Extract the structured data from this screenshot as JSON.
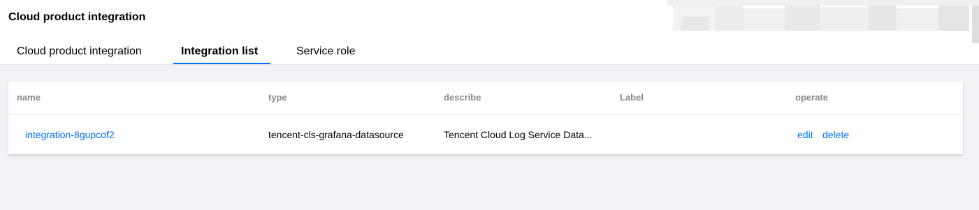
{
  "page": {
    "title": "Cloud product integration"
  },
  "tabs": [
    {
      "label": "Cloud product integration",
      "active": false
    },
    {
      "label": "Integration list",
      "active": true
    },
    {
      "label": "Service role",
      "active": false
    }
  ],
  "table": {
    "columns": [
      "name",
      "type",
      "describe",
      "Label",
      "operate"
    ],
    "rows": [
      {
        "name": "integration-8gupcof2",
        "type": "tencent-cls-grafana-datasource",
        "describe": "Tencent Cloud Log Service Data...",
        "label": "",
        "actions": [
          "edit",
          "delete"
        ]
      }
    ]
  },
  "colors": {
    "accent": "#006eff",
    "background": "#f2f3f6",
    "header_text": "#888888"
  }
}
